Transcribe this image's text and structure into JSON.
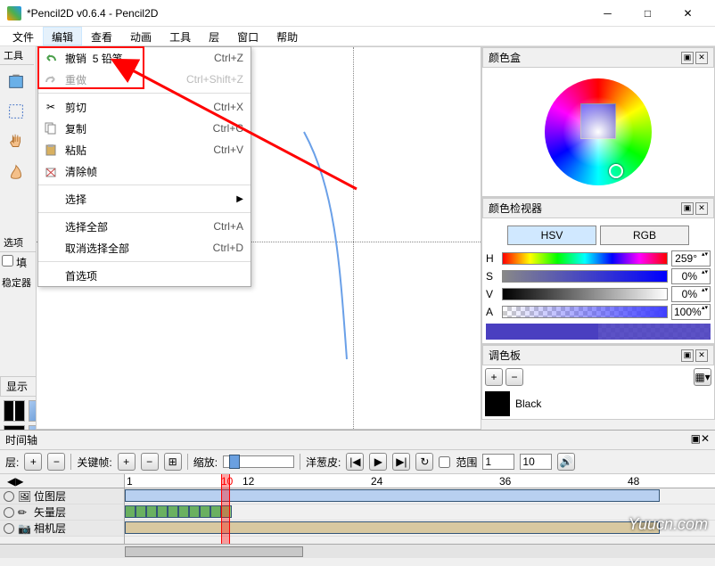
{
  "window": {
    "title": "*Pencil2D v0.6.4 - Pencil2D"
  },
  "menubar": [
    "文件",
    "编辑",
    "查看",
    "动画",
    "工具",
    "层",
    "窗口",
    "帮助"
  ],
  "edit_menu": {
    "undo": {
      "label": "撤销",
      "extra": "5 铅笔",
      "shortcut": "Ctrl+Z",
      "icon": "undo"
    },
    "redo": {
      "label": "重做",
      "shortcut": "Ctrl+Shift+Z",
      "icon": "redo",
      "disabled": true
    },
    "cut": {
      "label": "剪切",
      "shortcut": "Ctrl+X",
      "icon": "cut"
    },
    "copy": {
      "label": "复制",
      "shortcut": "Ctrl+C",
      "icon": "copy"
    },
    "paste": {
      "label": "粘贴",
      "shortcut": "Ctrl+V",
      "icon": "paste"
    },
    "clear": {
      "label": "清除帧",
      "icon": "clear"
    },
    "select": {
      "label": "选择"
    },
    "select_all": {
      "label": "选择全部",
      "shortcut": "Ctrl+A"
    },
    "deselect": {
      "label": "取消选择全部",
      "shortcut": "Ctrl+D"
    },
    "prefs": {
      "label": "首选项"
    }
  },
  "left": {
    "tools_title": "工具",
    "options_title": "选项",
    "fill_label": "填",
    "stabilizer_label": "稳定器",
    "display_title": "显示"
  },
  "right": {
    "colorbox": "颜色盒",
    "inspector": "颜色检视器",
    "hsv": "HSV",
    "rgb": "RGB",
    "h": {
      "l": "H",
      "v": "259°"
    },
    "s": {
      "l": "S",
      "v": "0%"
    },
    "v": {
      "l": "V",
      "v": "0%"
    },
    "a": {
      "l": "A",
      "v": "100%"
    },
    "palette": "调色板",
    "palette_item": "Black"
  },
  "timeline": {
    "title": "时间轴",
    "layers_label": "层:",
    "keyframe_label": "关键帧:",
    "zoom_label": "缩放:",
    "onion_label": "洋葱皮:",
    "range_label": "范围",
    "range_from": "1",
    "range_to": "10",
    "ruler": [
      "1",
      "12",
      "24",
      "36",
      "48"
    ],
    "playhead_text": "10",
    "layers": [
      {
        "name": "位图层",
        "type": "bitmap"
      },
      {
        "name": "矢量层",
        "type": "vector"
      },
      {
        "name": "相机层",
        "type": "camera"
      }
    ]
  },
  "watermark": "Yuucn.com"
}
